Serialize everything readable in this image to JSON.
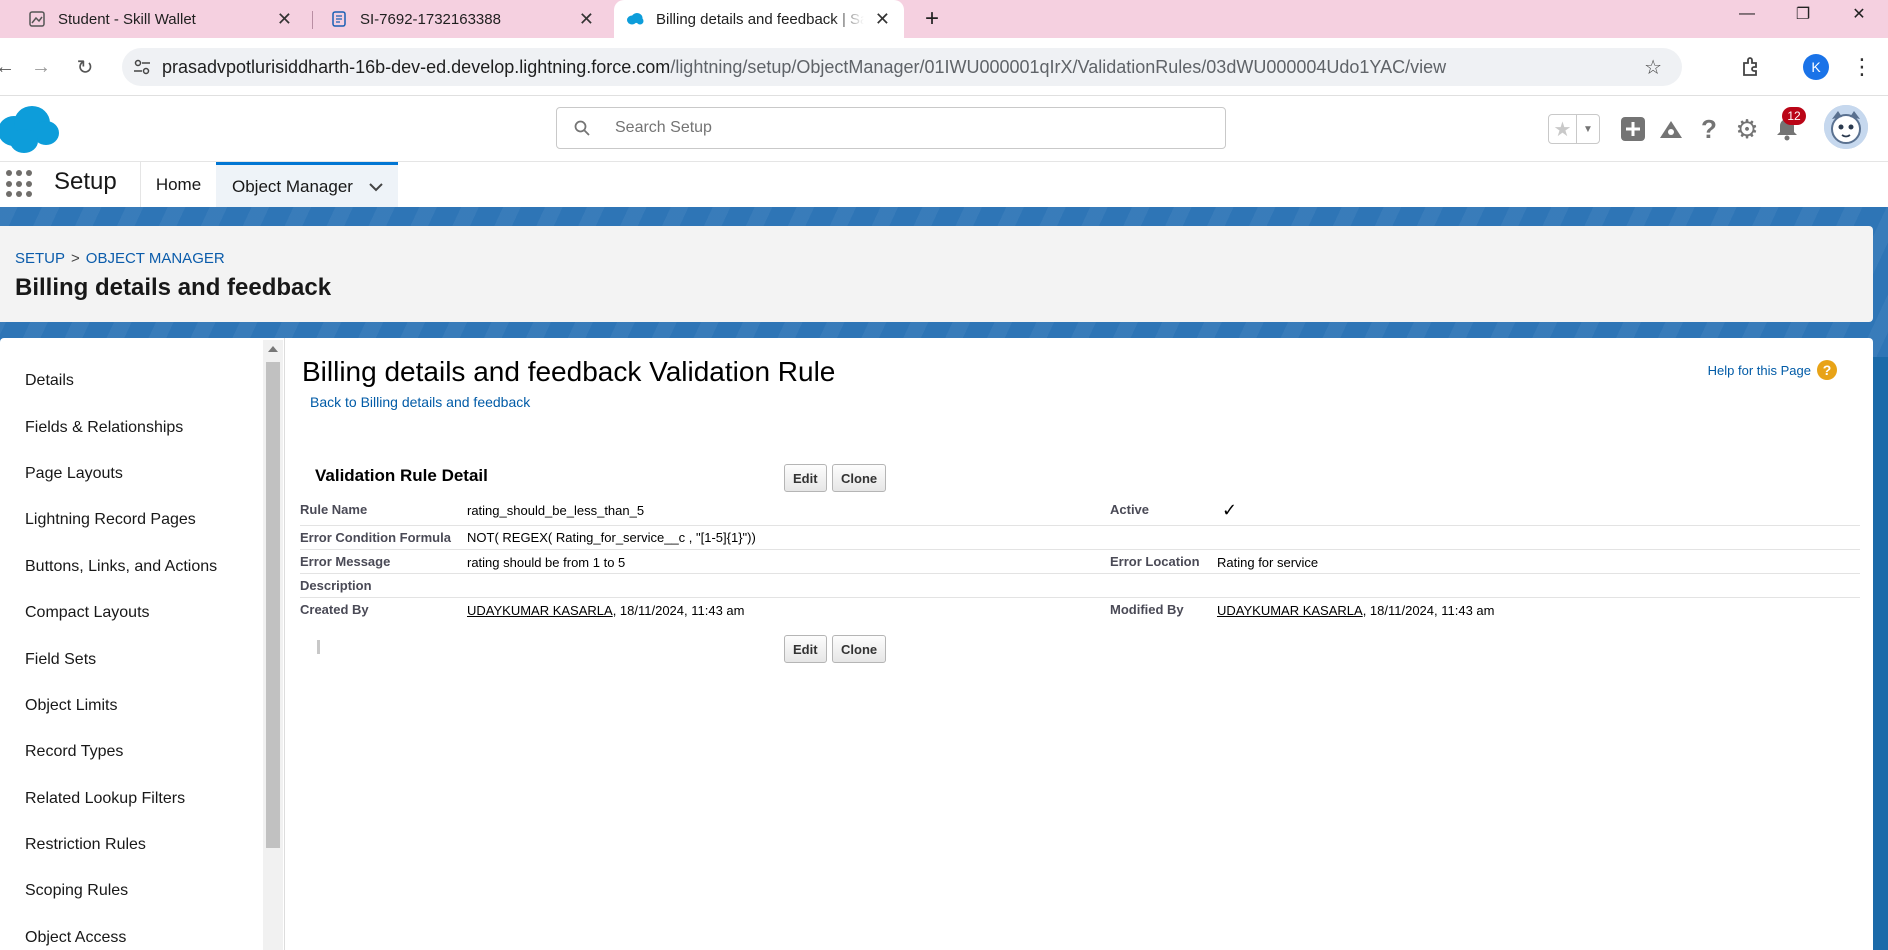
{
  "browser": {
    "tabs": [
      {
        "title": "Student - Skill Wallet",
        "icon": "image-icon"
      },
      {
        "title": "SI-7692-1732163388",
        "icon": "document-icon"
      },
      {
        "title": "Billing details and feedback | Sa",
        "icon": "salesforce-cloud-icon",
        "active": true
      }
    ],
    "url_host": "prasadvpotlurisiddharth-16b-dev-ed.develop.lightning.force.com",
    "url_path": "/lightning/setup/ObjectManager/01IWU000001qIrX/ValidationRules/03dWU000004Udo1YAC/view",
    "profile_initial": "K"
  },
  "sf_header": {
    "search_placeholder": "Search Setup",
    "notification_count": "12"
  },
  "app_nav": {
    "app_name": "Setup",
    "items": [
      {
        "label": "Home"
      },
      {
        "label": "Object Manager"
      }
    ]
  },
  "page_header": {
    "breadcrumb": [
      "SETUP",
      "OBJECT MANAGER"
    ],
    "title": "Billing details and feedback"
  },
  "sidebar": {
    "items": [
      {
        "label": "Details"
      },
      {
        "label": "Fields & Relationships"
      },
      {
        "label": "Page Layouts"
      },
      {
        "label": "Lightning Record Pages"
      },
      {
        "label": "Buttons, Links, and Actions"
      },
      {
        "label": "Compact Layouts"
      },
      {
        "label": "Field Sets"
      },
      {
        "label": "Object Limits"
      },
      {
        "label": "Record Types"
      },
      {
        "label": "Related Lookup Filters"
      },
      {
        "label": "Restriction Rules"
      },
      {
        "label": "Scoping Rules"
      },
      {
        "label": "Object Access"
      }
    ]
  },
  "content": {
    "title": "Billing details and feedback Validation Rule",
    "back_link": "Back to Billing details and feedback",
    "help_link": "Help for this Page",
    "section_title": "Validation Rule Detail",
    "edit_label": "Edit",
    "clone_label": "Clone",
    "fields": {
      "rule_name_label": "Rule Name",
      "rule_name": "rating_should_be_less_than_5",
      "active_label": "Active",
      "active_check": "✓",
      "formula_label": "Error Condition Formula",
      "formula": "NOT( REGEX( Rating_for_service__c , \"[1-5]{1}\"))",
      "message_label": "Error Message",
      "message": "rating should be from 1 to 5",
      "location_label": "Error Location",
      "location": "Rating for service",
      "description_label": "Description",
      "created_label": "Created By",
      "created_user": "UDAYKUMAR KASARLA",
      "created_date": ", 18/11/2024, 11:43 am",
      "modified_label": "Modified By",
      "modified_user": "UDAYKUMAR KASARLA",
      "modified_date": ", 18/11/2024, 11:43 am"
    }
  },
  "colors": {
    "tabstrip": "#f5d0e0",
    "brand_blue": "#1b6aa9",
    "link": "#015ba7",
    "badge": "#ba0517"
  }
}
